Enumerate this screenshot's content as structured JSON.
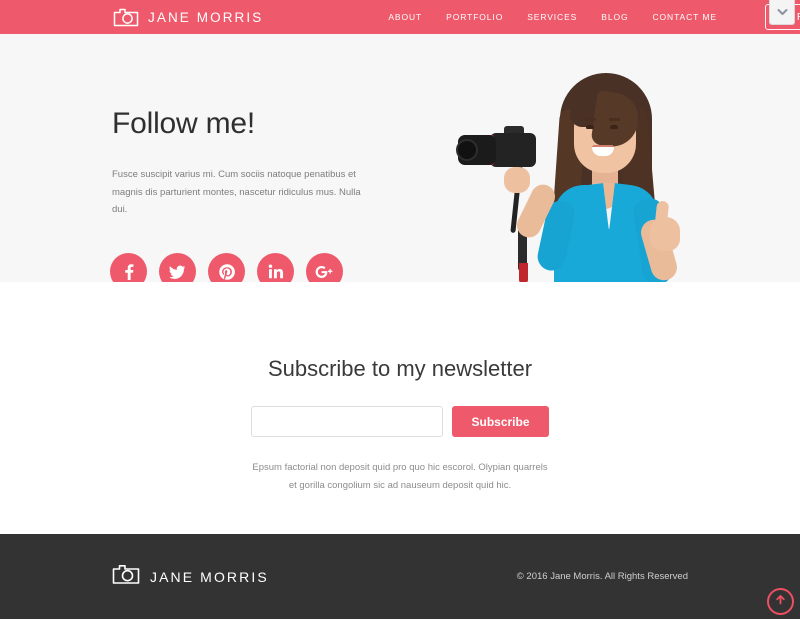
{
  "colors": {
    "brand_pink": "#ee5a6b",
    "hero_bg": "#f7f7f8",
    "footer_bg": "#333333",
    "page_bg": "#ffffff",
    "accent_blue": "#18a9d8"
  },
  "header": {
    "logo_icon": "camera-icon",
    "brand_name": "JANE MORRIS",
    "nav": [
      {
        "label": "ABOUT"
      },
      {
        "label": "PORTFOLIO"
      },
      {
        "label": "SERVICES"
      },
      {
        "label": "BLOG"
      },
      {
        "label": "CONTACT ME"
      }
    ],
    "resume_button": "My Resume",
    "top_right_chip_icon": "chevron-down-icon"
  },
  "hero": {
    "title": "Follow me!",
    "paragraph": "Fusce suscipit varius mi. Cum sociis natoque penatibus et magnis dis parturient montes, nascetur ridiculus mus. Nulla dui.",
    "social": [
      {
        "name": "facebook",
        "glyph": "f"
      },
      {
        "name": "twitter",
        "glyph": "t"
      },
      {
        "name": "pinterest",
        "glyph": "p"
      },
      {
        "name": "linkedin",
        "glyph": "in"
      },
      {
        "name": "googleplus",
        "glyph": "g+"
      }
    ],
    "photo_alt": "Smiling woman in blue top holding a DSLR camera and giving a thumbs up"
  },
  "newsletter": {
    "title": "Subscribe to my newsletter",
    "email_value": "",
    "email_placeholder": "",
    "subscribe_label": "Subscribe",
    "note": "Epsum factorial non deposit quid pro quo hic escorol. Olypian quarrels et gorilla congolium sic ad nauseum deposit quid hic."
  },
  "footer": {
    "logo_icon": "camera-icon",
    "brand_name": "JANE MORRIS",
    "copyright": "© 2016 Jane Morris. All Rights Reserved",
    "scroll_top_icon": "arrow-up-circle-icon"
  }
}
